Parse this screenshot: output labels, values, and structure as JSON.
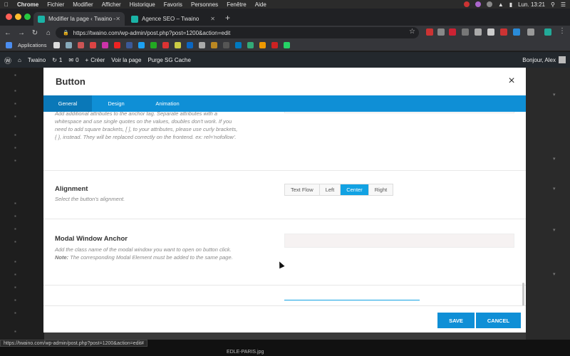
{
  "menubar": {
    "items": [
      "Chrome",
      "Fichier",
      "Modifier",
      "Afficher",
      "Historique",
      "Favoris",
      "Personnes",
      "Fenêtre",
      "Aide"
    ],
    "clock": "Lun. 13:21"
  },
  "tabs": [
    {
      "title": "Modifier la page ‹ Twaino — W",
      "active": true
    },
    {
      "title": "Agence SEO – Twaino",
      "active": false
    }
  ],
  "address": {
    "url": "https://twaino.com/wp-admin/post.php?post=1200&action=edit"
  },
  "bookmarks": {
    "apps_label": "Applications"
  },
  "adminbar": {
    "site": "Twaino",
    "updates": "1",
    "comments": "0",
    "create": "Créer",
    "view": "Voir la page",
    "purge": "Purge SG Cache",
    "greeting": "Bonjour, Alex"
  },
  "modal": {
    "title": "Button",
    "close_icon": "×",
    "tabs": [
      "General",
      "Design",
      "Animation"
    ],
    "active_tab": "General",
    "attributes_help": "Add additional attributes to the anchor tag. Separate attributes with a whitespace and use single quotes on the values, doubles don't work. If you need to add square brackets, [ ], to your attributes, please use curly brackets, { }, instead. They will be replaced correctly on the frontend. ex: rel='nofollow'.",
    "alignment": {
      "label": "Alignment",
      "help": "Select the button's alignment.",
      "options": [
        "Text Flow",
        "Left",
        "Center",
        "Right"
      ],
      "selected": "Center"
    },
    "modal_anchor": {
      "label": "Modal Window Anchor",
      "help_prefix": "Add the class name of the modal window you want to open on button click. ",
      "help_note": "Note:",
      "help_suffix": " The corresponding Modal Element must be added to the same page.",
      "value": ""
    },
    "save_label": "SAVE",
    "cancel_label": "CANCEL"
  },
  "statusbar": {
    "url": "https://twaino.com/wp-admin/post.php?post=1200&action=edit#",
    "filename": "EDLE-PARIS.jpg"
  },
  "colors": {
    "accent": "#0f8fd6",
    "selected": "#12a2e3"
  }
}
